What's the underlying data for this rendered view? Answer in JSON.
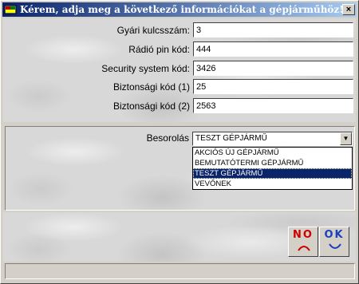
{
  "window": {
    "title": "Kérem, adja meg a következő információkat a gépjárműhöz!",
    "close_label": "×"
  },
  "fields": [
    {
      "label": "Gyári kulcsszám:",
      "value": "3"
    },
    {
      "label": "Rádió pin kód:",
      "value": "444"
    },
    {
      "label": "Security system kód:",
      "value": "3426"
    },
    {
      "label": "Biztonsági kód (1)",
      "value": "25"
    },
    {
      "label": "Biztonsági kód (2)",
      "value": "2563"
    }
  ],
  "besorolas": {
    "label": "Besorolás",
    "selected": "TESZT GÉPJÁRMŰ",
    "options": [
      "AKCIÓS ÚJ GÉPJÁRMŰ",
      "BEMUTATÓTERMI GÉPJÁRMŰ",
      "TESZT GÉPJÁRMŰ",
      "VEVŐNEK"
    ],
    "highlighted_index": 2
  },
  "buttons": {
    "no_label": "NO",
    "ok_label": "OK"
  },
  "colors": {
    "titlebar_start": "#0a246a",
    "titlebar_end": "#a6caf0",
    "no_text": "#cc0000",
    "ok_text": "#1a3fbf",
    "selection": "#0a246a"
  },
  "icons": {
    "app": "car-keys-icon",
    "no_face": "sad-face-icon",
    "ok_face": "smile-face-icon",
    "dropdown": "down-arrow-icon"
  },
  "statusbar": {
    "text": ""
  }
}
